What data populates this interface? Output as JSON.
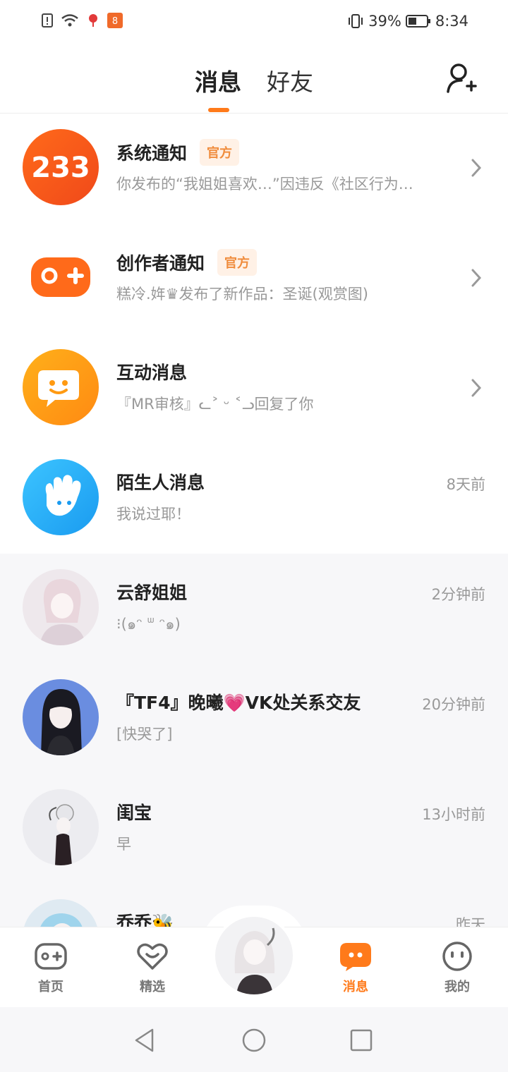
{
  "status_bar": {
    "battery": "39%",
    "time": "8:34"
  },
  "header": {
    "tab_messages": "消息",
    "tab_friends": "好友"
  },
  "messages": [
    {
      "name": "系统通知",
      "badge": "官方",
      "preview": "你发布的“我姐姐喜欢…”因违反《社区行为…"
    },
    {
      "name": "创作者通知",
      "badge": "官方",
      "preview": "糕冷.姩♛发布了新作品：圣诞(观赏图)"
    },
    {
      "name": "互动消息",
      "preview": "『MR审核』ᓚ˃ ᵕ ˂ᓗ回复了你"
    },
    {
      "name": "陌生人消息",
      "time": "8天前",
      "preview": "我说过耶！"
    },
    {
      "name": "云舒姐姐",
      "time": "2分钟前",
      "preview": "⁝(๑ᵔ ᐜ ᵔ๑)"
    },
    {
      "name": "『TF4』晚曦💗VK处关系交友",
      "time": "20分钟前",
      "preview": "[快哭了]"
    },
    {
      "name": "闺宝",
      "time": "13小时前",
      "preview": "早"
    },
    {
      "name": "乔乔🐝",
      "time": "昨天",
      "preview": ""
    }
  ],
  "tabbar": {
    "home": "首页",
    "featured": "精选",
    "messages": "消息",
    "mine": "我的"
  },
  "colors": {
    "accent": "#ff7a1a",
    "badge_bg": "#fff1e6",
    "badge_text": "#f08c3c"
  }
}
